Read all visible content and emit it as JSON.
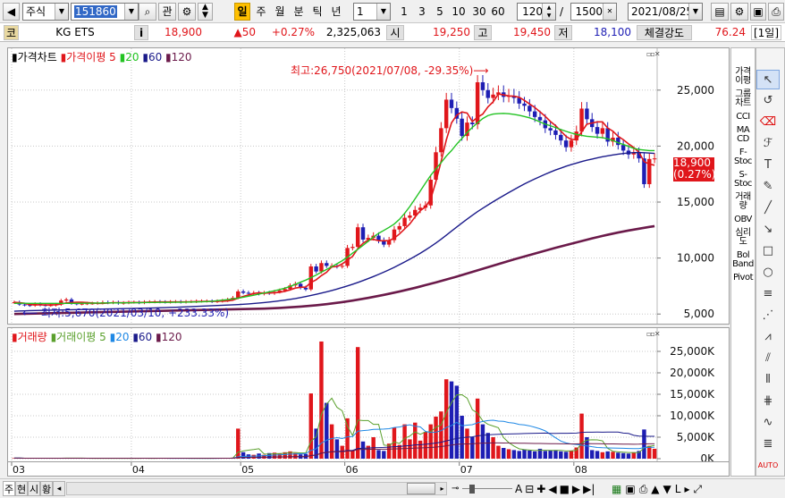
{
  "toolbar": {
    "market": "주식",
    "code": "151860",
    "btn_gwan": "관",
    "periods": [
      "일",
      "주",
      "월",
      "분",
      "틱",
      "년"
    ],
    "interval_value": "1",
    "quick": [
      "1",
      "3",
      "5",
      "10",
      "30",
      "60"
    ],
    "count": "120",
    "slash": "/",
    "total": "1500",
    "date": "2021/08/25"
  },
  "info": {
    "market_badge": "코",
    "name": "KG ETS",
    "info_icon": "i",
    "price": "18,900",
    "change": "▲50",
    "change_pct": "+0.27%",
    "volume": "2,325,063",
    "open_label": "시",
    "open": "19,250",
    "high_label": "고",
    "high": "19,450",
    "low_label": "저",
    "low": "18,100",
    "strength_label": "체결강도",
    "strength": "76.24",
    "period_badge": "[1일]"
  },
  "price_legend": [
    "▮가격차트",
    "▮가격이평 5",
    "▮20",
    "▮60",
    "▮120"
  ],
  "volume_legend": [
    "▮거래량",
    "▮거래이평 5",
    "▮20",
    "▮60",
    "▮120"
  ],
  "annotations": {
    "high": "최고:26,750(2021/07/08, -29.35%)⟶",
    "low": "⟵ 최저:5,670(2021/03/10, +233.33%)"
  },
  "price_label": {
    "value": "18,900",
    "pct": "(0.27%)"
  },
  "indicators": [
    "가격 이평",
    "그룹 차트",
    "CCI",
    "MA CD",
    "F-Stoc",
    "S-Stoc",
    "거래 량",
    "OBV",
    "심리 도",
    "Bol Band",
    "Pivot"
  ],
  "status": {
    "tabs": [
      "주",
      "현",
      "시",
      "황"
    ]
  },
  "colors": {
    "up": "#e0161b",
    "down": "#1e1eb4",
    "ma5": "#e0161b",
    "ma20": "#22c322",
    "ma60": "#1a1a8a",
    "ma120": "#6b1a4a"
  },
  "chart_data": [
    {
      "type": "candlestick",
      "title": "가격차트",
      "x_ticks": [
        "03",
        "04",
        "05",
        "06",
        "07",
        "08"
      ],
      "y_ticks": [
        "5,000",
        "10,000",
        "15,000",
        "20,000",
        "25,000"
      ],
      "ylim": [
        4300,
        27300
      ],
      "months": [
        {
          "label": "03",
          "start": 0
        },
        {
          "label": "04",
          "start": 23
        },
        {
          "label": "05",
          "start": 44
        },
        {
          "label": "06",
          "start": 64
        },
        {
          "label": "07",
          "start": 86
        },
        {
          "label": "08",
          "start": 108
        }
      ],
      "close": [
        6050,
        5850,
        5800,
        5760,
        5900,
        5800,
        5780,
        5790,
        5850,
        6200,
        6300,
        5950,
        5900,
        5920,
        5950,
        5950,
        5980,
        6050,
        6000,
        6050,
        5950,
        6000,
        6050,
        6050,
        6000,
        6080,
        6080,
        6100,
        6080,
        6060,
        6090,
        6100,
        6060,
        6100,
        6100,
        6150,
        6150,
        6150,
        6110,
        6150,
        6200,
        6300,
        6450,
        7020,
        6900,
        6850,
        6890,
        6800,
        6900,
        6850,
        6980,
        7100,
        7230,
        7550,
        7700,
        7350,
        7200,
        9250,
        8800,
        9550,
        9300,
        9300,
        9250,
        9300,
        10900,
        11000,
        12750,
        11650,
        11800,
        12000,
        11550,
        11200,
        11600,
        12550,
        12850,
        13600,
        13800,
        14300,
        14500,
        14700,
        17000,
        19450,
        21600,
        24150,
        23400,
        22450,
        20900,
        22100,
        21950,
        25700,
        25000,
        24300,
        24600,
        24800,
        24400,
        24500,
        24300,
        23800,
        23600,
        23100,
        22600,
        22300,
        21600,
        21400,
        21000,
        20500,
        19900,
        20500,
        21300,
        23350,
        22400,
        21700,
        21100,
        21600,
        20400,
        20750,
        20100,
        19600,
        19250,
        19400,
        18900,
        16600,
        18850,
        18900
      ],
      "series": [
        {
          "name": "5",
          "values": [
            6050,
            6010,
            5960,
            5840,
            5820,
            5820,
            5810,
            5820,
            5820,
            5890,
            5990,
            6020,
            6050,
            6050,
            6020,
            5990,
            5950,
            5950,
            5980,
            6010,
            6010,
            6010,
            6020,
            6030,
            6030,
            6040,
            6060,
            6070,
            6080,
            6080,
            6080,
            6080,
            6080,
            6080,
            6090,
            6110,
            6120,
            6130,
            6130,
            6150,
            6150,
            6170,
            6240,
            6420,
            6570,
            6700,
            6830,
            6900,
            6870,
            6880,
            6900,
            6940,
            7030,
            7160,
            7320,
            7390,
            7410,
            7820,
            8060,
            8430,
            8730,
            9220,
            9240,
            9480,
            9810,
            10150,
            10840,
            11320,
            11620,
            11670,
            11550,
            11540,
            11560,
            11780,
            12150,
            12600,
            13060,
            13670,
            14230,
            14580,
            15260,
            16830,
            18630,
            20550,
            22080,
            22760,
            23050,
            22950,
            22190,
            22580,
            22860,
            23500,
            23960,
            24650,
            24580,
            24480,
            24460,
            24360,
            24080,
            23760,
            23450,
            23060,
            22660,
            22200,
            21820,
            21350,
            20870,
            20590,
            20620,
            21270,
            21960,
            22060,
            22160,
            22160,
            21620,
            21330,
            20880,
            20570,
            20200,
            19880,
            19450,
            18610,
            18400,
            18290
          ]
        },
        {
          "name": "20",
          "values": [
            5950,
            5960,
            5960,
            5950,
            5950,
            5950,
            5950,
            5950,
            5950,
            5950,
            5950,
            5950,
            5950,
            5960,
            5960,
            5970,
            5980,
            5980,
            5990,
            5990,
            5990,
            6000,
            6000,
            6010,
            6010,
            6020,
            6030,
            6030,
            6040,
            6040,
            6040,
            6050,
            6050,
            6060,
            6070,
            6080,
            6090,
            6110,
            6140,
            6190,
            6240,
            6290,
            6350,
            6420,
            6500,
            6590,
            6680,
            6780,
            6880,
            6980,
            7080,
            7190,
            7310,
            7470,
            7650,
            7850,
            8030,
            8250,
            8480,
            8740,
            8980,
            9230,
            9490,
            9760,
            10080,
            10440,
            10780,
            11130,
            11500,
            11880,
            12210,
            12470,
            12740,
            13040,
            13460,
            14000,
            14610,
            15290,
            15990,
            16700,
            17380,
            17970,
            18520,
            19110,
            19600,
            20180,
            20680,
            21210,
            21670,
            22080,
            22460,
            22730,
            22860,
            22900,
            22920,
            22890,
            22830,
            22750,
            22640,
            22520,
            22360,
            22160,
            21960,
            21820,
            21650,
            21480,
            21320,
            21170,
            21050,
            20960,
            20880,
            20840,
            20800,
            20760,
            20650,
            20500,
            20300,
            20150,
            19980,
            19800,
            19700,
            19650,
            19600,
            19600
          ]
        },
        {
          "name": "60",
          "values": [
            5250,
            5270,
            5280,
            5300,
            5310,
            5320,
            5330,
            5340,
            5350,
            5360,
            5370,
            5380,
            5390,
            5400,
            5410,
            5420,
            5430,
            5440,
            5450,
            5460,
            5470,
            5480,
            5490,
            5500,
            5510,
            5520,
            5530,
            5540,
            5560,
            5570,
            5590,
            5600,
            5620,
            5640,
            5660,
            5680,
            5700,
            5720,
            5740,
            5760,
            5780,
            5800,
            5820,
            5840,
            5870,
            5900,
            5940,
            5980,
            6020,
            6070,
            6120,
            6180,
            6240,
            6310,
            6380,
            6470,
            6560,
            6660,
            6760,
            6870,
            6980,
            7100,
            7230,
            7370,
            7510,
            7660,
            7820,
            7990,
            8170,
            8350,
            8540,
            8740,
            8950,
            9170,
            9410,
            9650,
            9900,
            10160,
            10430,
            10720,
            11020,
            11340,
            11680,
            12040,
            12410,
            12770,
            13130,
            13480,
            13820,
            14150,
            14450,
            14740,
            15030,
            15310,
            15580,
            15850,
            16110,
            16370,
            16620,
            16850,
            17070,
            17280,
            17490,
            17680,
            17870,
            18030,
            18200,
            18350,
            18480,
            18620,
            18740,
            18840,
            18950,
            19050,
            19130,
            19210,
            19280,
            19340,
            19390,
            19420,
            19430,
            19410,
            19380,
            19350
          ]
        },
        {
          "name": "120",
          "values": [
            5000,
            5010,
            5020,
            5030,
            5040,
            5050,
            5060,
            5070,
            5080,
            5090,
            5100,
            5110,
            5120,
            5130,
            5140,
            5150,
            5160,
            5170,
            5180,
            5190,
            5200,
            5210,
            5220,
            5230,
            5240,
            5250,
            5260,
            5270,
            5280,
            5290,
            5300,
            5310,
            5320,
            5330,
            5340,
            5350,
            5360,
            5370,
            5380,
            5390,
            5400,
            5410,
            5420,
            5430,
            5440,
            5450,
            5460,
            5470,
            5480,
            5500,
            5520,
            5540,
            5570,
            5600,
            5630,
            5660,
            5700,
            5740,
            5780,
            5830,
            5880,
            5940,
            6000,
            6060,
            6130,
            6200,
            6280,
            6360,
            6440,
            6530,
            6620,
            6710,
            6810,
            6910,
            7010,
            7120,
            7230,
            7340,
            7460,
            7580,
            7700,
            7820,
            7950,
            8080,
            8210,
            8340,
            8480,
            8620,
            8760,
            8900,
            9040,
            9180,
            9320,
            9460,
            9600,
            9740,
            9880,
            10010,
            10140,
            10270,
            10400,
            10530,
            10660,
            10790,
            10920,
            11040,
            11160,
            11280,
            11400,
            11520,
            11640,
            11760,
            11870,
            11980,
            12080,
            12180,
            12280,
            12370,
            12460,
            12540,
            12620,
            12700,
            12780,
            12850
          ]
        }
      ]
    },
    {
      "type": "bar",
      "title": "거래량",
      "y_ticks": [
        "0K",
        "5,000K",
        "10,000K",
        "15,000K",
        "20,000K",
        "25,000K"
      ],
      "ylim": [
        0,
        27500000
      ],
      "values": [
        120000,
        150000,
        80000,
        90000,
        110000,
        100000,
        95000,
        85000,
        100000,
        200000,
        150000,
        120000,
        90000,
        80000,
        70000,
        90000,
        80000,
        70000,
        90000,
        80000,
        85000,
        100000,
        90000,
        80000,
        90000,
        100000,
        85000,
        90000,
        95000,
        100000,
        90000,
        85000,
        95000,
        90000,
        80000,
        95000,
        90000,
        85000,
        95000,
        100000,
        110000,
        120000,
        250000,
        7000000,
        1500000,
        1000000,
        900000,
        1200000,
        900000,
        1300000,
        1400000,
        1200000,
        1500000,
        1700000,
        1300000,
        1000000,
        1100000,
        15200000,
        7000000,
        27300000,
        13000000,
        8000000,
        4500000,
        3000000,
        9400000,
        2000000,
        26000000,
        4000000,
        3000000,
        5000000,
        2000000,
        1800000,
        3500000,
        7200000,
        3200000,
        8000000,
        4500000,
        8400000,
        4200000,
        6200000,
        8000000,
        9800000,
        11000000,
        18500000,
        18000000,
        17000000,
        10000000,
        7000000,
        5000000,
        14000000,
        8000000,
        6000000,
        5000000,
        3000000,
        2500000,
        2200000,
        2000000,
        1800000,
        2100000,
        1900000,
        1700000,
        2300000,
        1800000,
        1900000,
        2000000,
        1700000,
        1600000,
        1900000,
        2600000,
        10500000,
        5000000,
        2000000,
        1800000,
        1500000,
        1700000,
        1600000,
        1400000,
        1300000,
        1200000,
        1500000,
        1800000,
        6800000,
        3000000,
        2300000
      ]
    }
  ]
}
